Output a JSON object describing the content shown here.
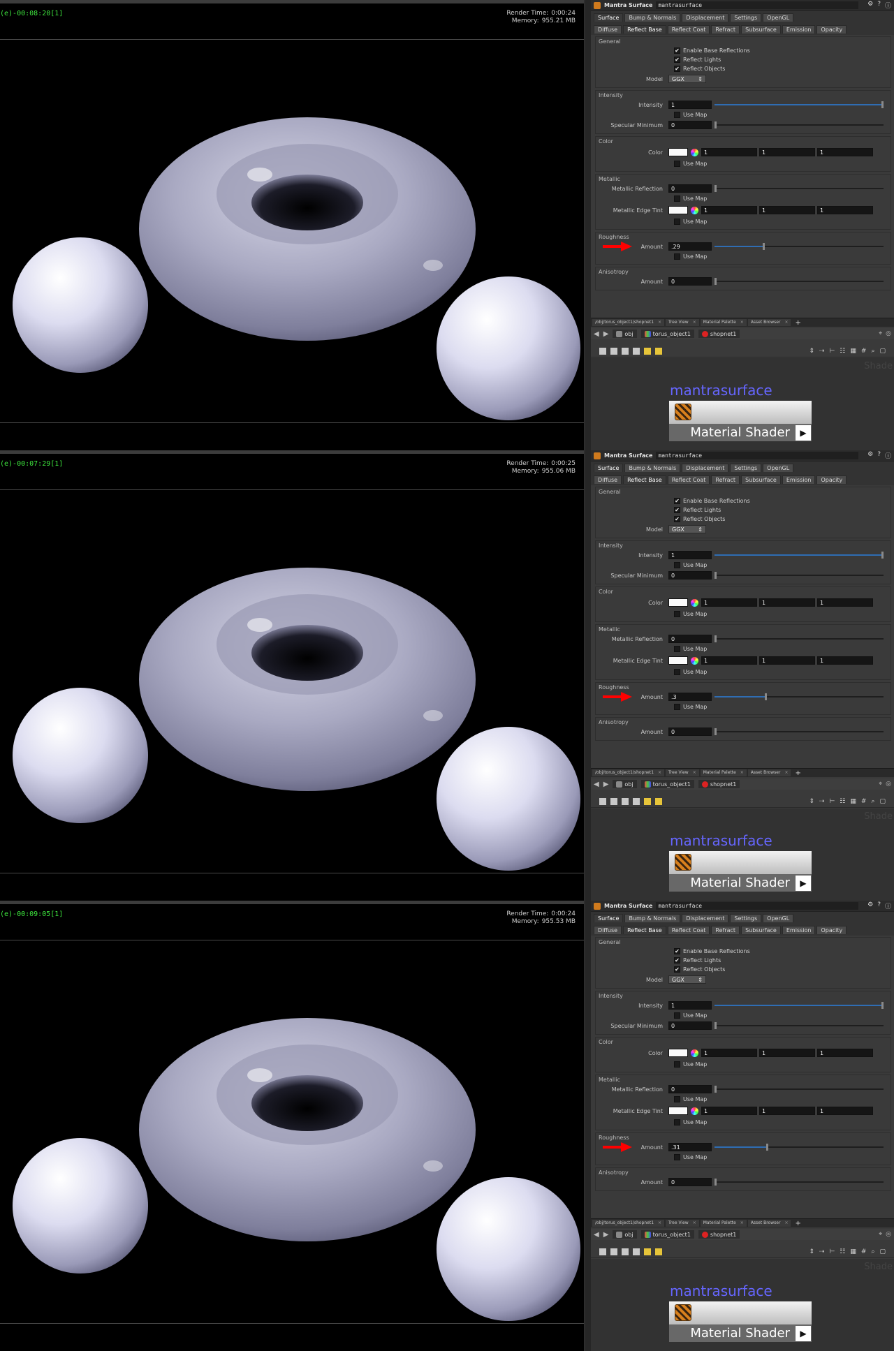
{
  "panels": [
    {
      "render_time_clock": "(e)-00:08:20[1]",
      "render_time_label": "Render Time:",
      "render_time_value": "0:00:24",
      "memory_label": "Memory:",
      "memory_value": "955.21 MB",
      "roughness_amount": ".29",
      "roughness_fraction": 0.29
    },
    {
      "render_time_clock": "(e)-00:07:29[1]",
      "render_time_label": "Render Time:",
      "render_time_value": "0:00:25",
      "memory_label": "Memory:",
      "memory_value": "955.06 MB",
      "roughness_amount": ".3",
      "roughness_fraction": 0.3
    },
    {
      "render_time_clock": "(e)-00:09:05[1]",
      "render_time_label": "Render Time:",
      "render_time_value": "0:00:24",
      "memory_label": "Memory:",
      "memory_value": "955.53 MB",
      "roughness_amount": ".31",
      "roughness_fraction": 0.31
    }
  ],
  "param_editor": {
    "node_type": "Mantra Surface",
    "node_name": "mantrasurface",
    "tabs_primary": [
      "Surface",
      "Bump & Normals",
      "Displacement",
      "Settings",
      "OpenGL"
    ],
    "tabs_secondary": [
      "Diffuse",
      "Reflect Base",
      "Reflect Coat",
      "Refract",
      "Subsurface",
      "Emission",
      "Opacity"
    ],
    "active_secondary": "Reflect Base",
    "general": {
      "title": "General",
      "enable_base_reflections": "Enable Base Reflections",
      "reflect_lights": "Reflect Lights",
      "reflect_objects": "Reflect Objects",
      "model_label": "Model",
      "model_value": "GGX",
      "checked_mark": "✔"
    },
    "intensity": {
      "title": "Intensity",
      "intensity_label": "Intensity",
      "intensity_value": "1",
      "use_map": "Use Map",
      "spec_min_label": "Specular Minimum",
      "spec_min_value": "0"
    },
    "color": {
      "title": "Color",
      "color_label": "Color",
      "r": "1",
      "g": "1",
      "b": "1",
      "use_map": "Use Map",
      "swatch_color": "#fafafa"
    },
    "metallic": {
      "title": "Metallic",
      "reflection_label": "Metallic Reflection",
      "reflection_value": "0",
      "use_map": "Use Map",
      "edge_tint_label": "Metallic Edge Tint",
      "r": "1",
      "g": "1",
      "b": "1",
      "use_map_2": "Use Map"
    },
    "roughness": {
      "title": "Roughness",
      "amount_label": "Amount",
      "use_map": "Use Map"
    },
    "anisotropy": {
      "title": "Anisotropy",
      "amount_label": "Amount",
      "amount_value": "0"
    }
  },
  "network": {
    "tabs": [
      "/obj/torus_object1/shopnet1",
      "Tree View",
      "Material Palette",
      "Asset Browser"
    ],
    "tab_close": "×",
    "add_tab": "+",
    "path_root": "obj",
    "path_object": "torus_object1",
    "path_shopnet": "shopnet1",
    "watermark": "Shade",
    "node_label": "mantrasurface",
    "node_type_label": "Material Shader",
    "play_glyph": "▶",
    "back_glyph": "◀",
    "forward_glyph": "▶"
  },
  "colors": {
    "clock_green": "#3ee63e",
    "node_name_blue": "#6666ff",
    "arrow_red": "#ff0000",
    "slider_blue": "#2f6db3"
  }
}
